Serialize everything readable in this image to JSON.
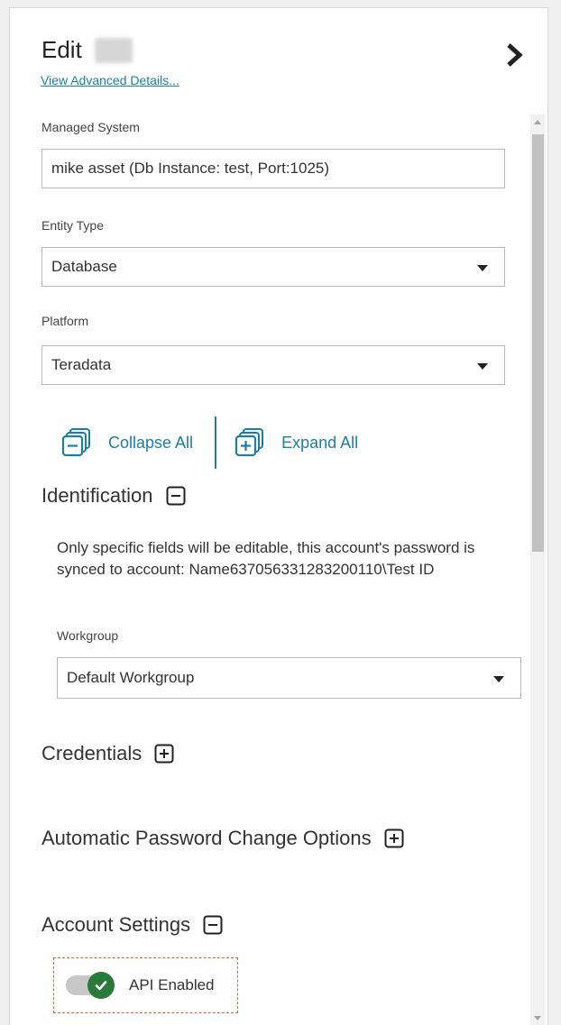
{
  "header": {
    "title": "Edit",
    "advanced_link": "View Advanced Details..."
  },
  "managed_system": {
    "label": "Managed System",
    "value": "mike asset (Db Instance: test, Port:1025)"
  },
  "entity_type": {
    "label": "Entity Type",
    "value": "Database"
  },
  "platform": {
    "label": "Platform",
    "value": "Teradata"
  },
  "expand_controls": {
    "collapse_label": "Collapse All",
    "expand_label": "Expand All"
  },
  "sections": {
    "identification": "Identification",
    "credentials": "Credentials",
    "auto_password": "Automatic Password Change Options",
    "account_settings": "Account Settings"
  },
  "identification": {
    "sync_note": "Only specific fields will be editable, this account's password is synced to account: Name637056331283200110\\Test ID",
    "workgroup_label": "Workgroup",
    "workgroup_value": "Default Workgroup"
  },
  "account_settings": {
    "api_toggle_label": "API Enabled",
    "api_enabled": true
  },
  "colors": {
    "accent": "#1a7fa5",
    "toggle_on": "#2a7a3b",
    "focus_outline": "#e2652b"
  },
  "icons": {
    "collapse_all": "collapse-all-icon",
    "expand_all": "expand-all-icon",
    "section_collapse": "minus-square-icon",
    "section_expand": "plus-square-icon",
    "close_panel": "chevron-right-icon",
    "dropdown": "caret-down-icon"
  }
}
